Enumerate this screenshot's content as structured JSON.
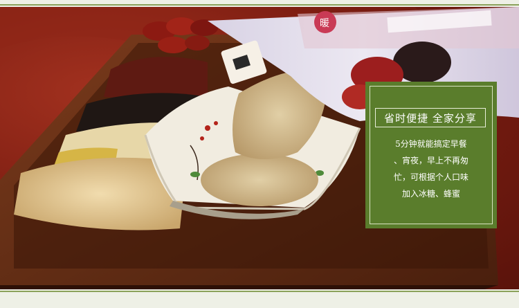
{
  "panel": {
    "title": "省时便捷 全家分享",
    "body_lines": [
      "5分钟就能搞定早餐",
      "、宵夜，早上不再匆",
      "忙，可根据个人口味",
      "加入冰糖、蜂蜜"
    ]
  },
  "package_text": "暖",
  "colors": {
    "panel_bg": "#5a7d2c",
    "frame": "#8aa15a",
    "cloth": "#7e1e12"
  }
}
